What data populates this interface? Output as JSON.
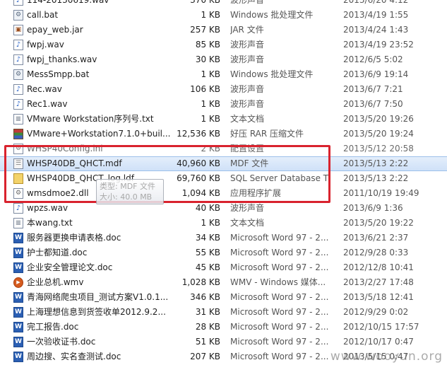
{
  "files": [
    {
      "name": "114-20130619.wav",
      "size": "370 KB",
      "type": "波形声音",
      "date": "2013/6/20 4:12",
      "icon": "wav-icon",
      "kind": "wav"
    },
    {
      "name": "call.bat",
      "size": "1 KB",
      "type": "Windows 批处理文件",
      "date": "2013/4/19 1:55",
      "icon": "batch-file-icon",
      "kind": "bat"
    },
    {
      "name": "epay_web.jar",
      "size": "257 KB",
      "type": "JAR 文件",
      "date": "2013/4/24 1:43",
      "icon": "jar-file-icon",
      "kind": "jar"
    },
    {
      "name": "fwpj.wav",
      "size": "85 KB",
      "type": "波形声音",
      "date": "2013/4/19 23:52",
      "icon": "wav-icon",
      "kind": "wav"
    },
    {
      "name": "fwpj_thanks.wav",
      "size": "30 KB",
      "type": "波形声音",
      "date": "2012/6/5 5:02",
      "icon": "wav-icon",
      "kind": "wav"
    },
    {
      "name": "MessSmpp.bat",
      "size": "1 KB",
      "type": "Windows 批处理文件",
      "date": "2013/6/9 19:14",
      "icon": "batch-file-icon",
      "kind": "bat"
    },
    {
      "name": "Rec.wav",
      "size": "106 KB",
      "type": "波形声音",
      "date": "2013/6/7 7:21",
      "icon": "wav-icon",
      "kind": "wav"
    },
    {
      "name": "Rec1.wav",
      "size": "1 KB",
      "type": "波形声音",
      "date": "2013/6/7 7:50",
      "icon": "wav-icon",
      "kind": "wav"
    },
    {
      "name": "VMware Workstation序列号.txt",
      "size": "1 KB",
      "type": "文本文档",
      "date": "2013/5/20 19:26",
      "icon": "text-file-icon",
      "kind": "txt"
    },
    {
      "name": "VMware+Workstation7.1.0+buil...",
      "size": "12,536 KB",
      "type": "好压 RAR 压缩文件",
      "date": "2013/5/20 19:24",
      "icon": "rar-archive-icon",
      "kind": "rar"
    },
    {
      "name": "WHSP40Config.ini",
      "size": "2 KB",
      "type": "配置设置",
      "date": "2013/5/12 20:58",
      "icon": "config-file-icon",
      "kind": "ini",
      "cut": true
    },
    {
      "name": "WHSP40DB_QHCT.mdf",
      "size": "40,960 KB",
      "type": "MDF 文件",
      "date": "2013/5/13 2:22",
      "icon": "database-file-icon",
      "kind": "mdf",
      "selected": true
    },
    {
      "name": "WHSP40DB_QHCT_log.ldf",
      "size": "69,760 KB",
      "type": "SQL Server Database T...",
      "date": "2013/5/13 2:22",
      "icon": "database-log-icon",
      "kind": "ldf"
    },
    {
      "name": "wmsdmoe2.dll",
      "size": "1,094 KB",
      "type": "应用程序扩展",
      "date": "2011/10/19 19:49",
      "icon": "dll-file-icon",
      "kind": "dll"
    },
    {
      "name": "wpzs.wav",
      "size": "40 KB",
      "type": "波形声音",
      "date": "2013/6/9 1:36",
      "icon": "wav-icon",
      "kind": "wav"
    },
    {
      "name": "本wang.txt",
      "size": "1 KB",
      "type": "文本文档",
      "date": "2013/5/20 19:22",
      "icon": "text-file-icon",
      "kind": "txt"
    },
    {
      "name": "服务器更换申请表格.doc",
      "size": "34 KB",
      "type": "Microsoft Word 97 - 2...",
      "date": "2013/6/21 2:37",
      "icon": "word-document-icon",
      "kind": "doc"
    },
    {
      "name": "护士都知道.doc",
      "size": "55 KB",
      "type": "Microsoft Word 97 - 2...",
      "date": "2012/9/28 0:33",
      "icon": "word-document-icon",
      "kind": "doc"
    },
    {
      "name": "企业安全管理论文.doc",
      "size": "45 KB",
      "type": "Microsoft Word 97 - 2...",
      "date": "2012/12/8 10:41",
      "icon": "word-document-icon",
      "kind": "doc"
    },
    {
      "name": "企业总机.wmv",
      "size": "1,028 KB",
      "type": "WMV - Windows 媒体...",
      "date": "2013/2/27 17:48",
      "icon": "video-file-icon",
      "kind": "wmv"
    },
    {
      "name": "青海网络爬虫项目_测试方案V1.0.1...",
      "size": "346 KB",
      "type": "Microsoft Word 97 - 2...",
      "date": "2013/5/18 12:41",
      "icon": "word-document-icon",
      "kind": "doc"
    },
    {
      "name": "上海理想信息到货签收单2012.9.2...",
      "size": "31 KB",
      "type": "Microsoft Word 97 - 2...",
      "date": "2012/9/29 0:02",
      "icon": "word-document-icon",
      "kind": "doc"
    },
    {
      "name": "完工报告.doc",
      "size": "28 KB",
      "type": "Microsoft Word 97 - 2...",
      "date": "2012/10/15 17:57",
      "icon": "word-document-icon",
      "kind": "doc"
    },
    {
      "name": "一次验收证书.doc",
      "size": "51 KB",
      "type": "Microsoft Word 97 - 2...",
      "date": "2012/10/17 0:47",
      "icon": "word-document-icon",
      "kind": "doc"
    },
    {
      "name": "周边搜、实名查测试.doc",
      "size": "207 KB",
      "type": "Microsoft Word 97 - 2...",
      "date": "2013/5/15 0:47",
      "icon": "word-document-icon",
      "kind": "doc"
    }
  ],
  "tooltip": {
    "type_line": "类型: MDF 文件",
    "size_line": "大小: 40.0 MB"
  },
  "watermark": "www.wooyun.org",
  "colors": {
    "highlight_box": "#d9232e",
    "selection": "#cfe1f8"
  }
}
